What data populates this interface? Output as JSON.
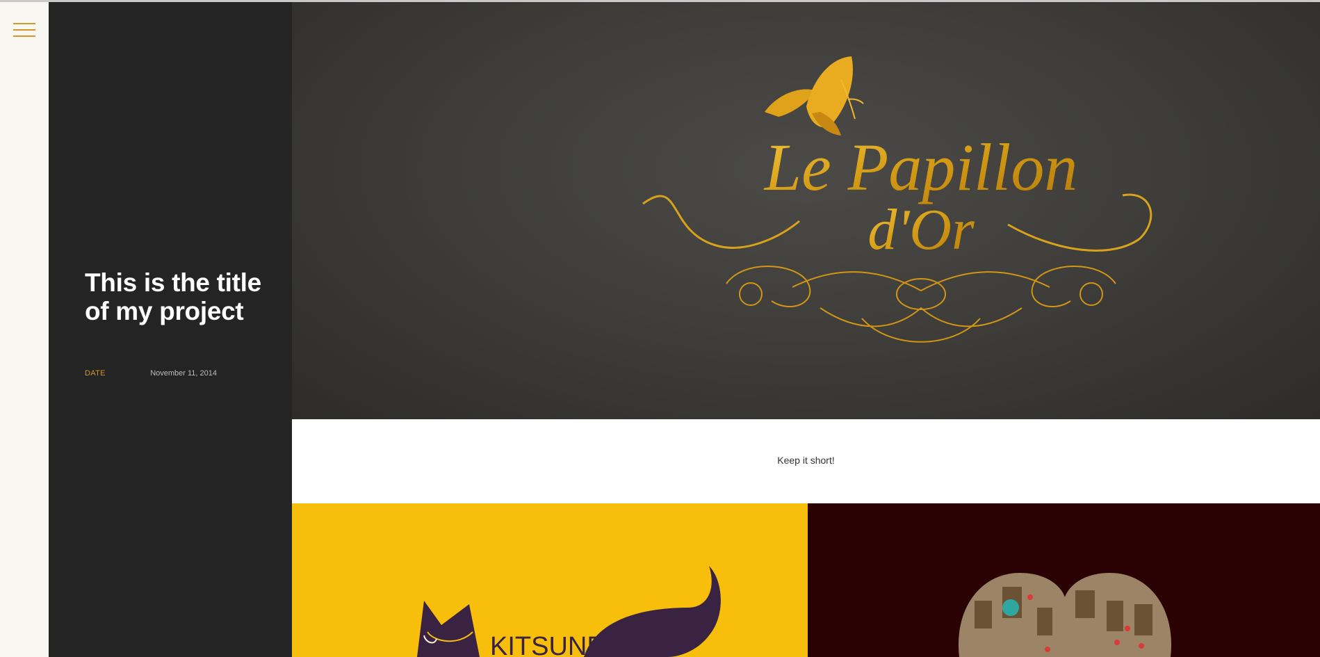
{
  "menu": {
    "icon": "hamburger-menu-icon"
  },
  "project": {
    "title": "This is the title of my project",
    "date_label": "DATE",
    "date_value": "November 11, 2014"
  },
  "hero": {
    "line1": "Le Papillon",
    "line2": "d'Or",
    "icon": "butterfly-icon"
  },
  "caption": {
    "text": "Keep it short!"
  },
  "tiles": {
    "left_text": "KITSUNE",
    "left_icon": "fox-illustration",
    "right_icon": "heart-houses-illustration"
  },
  "colors": {
    "accent": "#d4982a",
    "panel": "#242424",
    "yellow": "#f7bf0b",
    "maroon": "#2a0203"
  }
}
